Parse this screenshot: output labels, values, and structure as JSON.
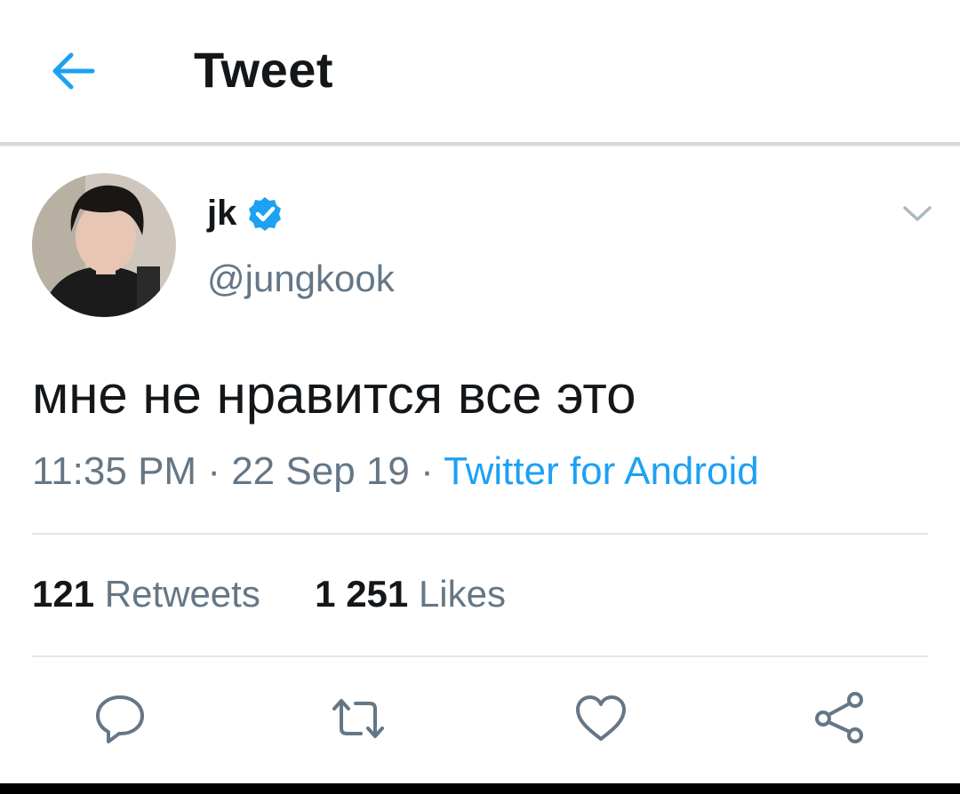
{
  "header": {
    "title": "Tweet",
    "back_icon": "arrow-left-icon"
  },
  "tweet": {
    "author": {
      "display_name": "jk",
      "handle": "@jungkook",
      "verified": true
    },
    "text": "мне не нравится все это",
    "time": "11:35 PM",
    "date": "22 Sep 19",
    "separator": "·",
    "source": "Twitter for Android",
    "stats": {
      "retweets_count": "121",
      "retweets_label": "Retweets",
      "likes_count": "1 251",
      "likes_label": "Likes"
    }
  },
  "actions": [
    "reply-icon",
    "retweet-icon",
    "like-icon",
    "share-icon"
  ],
  "colors": {
    "accent": "#1da1f2",
    "text": "#14171a",
    "secondary": "#657786",
    "divider": "#e1e8ed"
  }
}
